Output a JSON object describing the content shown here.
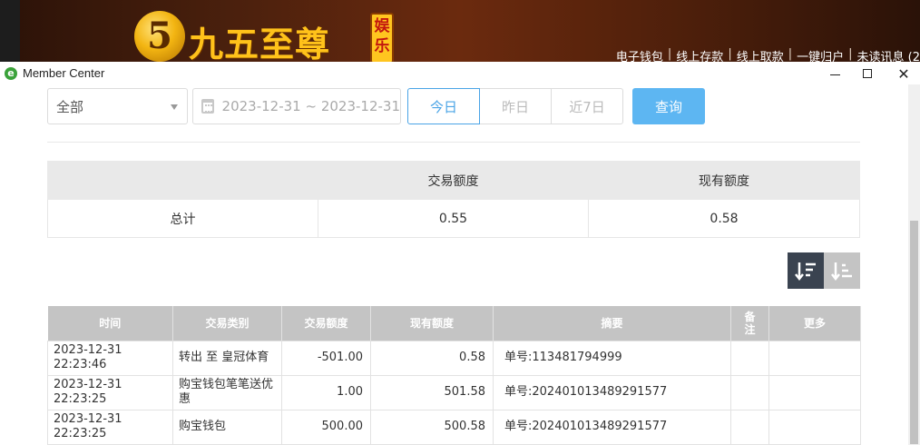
{
  "site": {
    "logo_number": "5",
    "logo_text": "九五至尊",
    "logo_tag": [
      "娱",
      "乐"
    ],
    "nav_links": [
      "电子钱包",
      "线上存款",
      "线上取款",
      "一键归户",
      "未读讯息 (2"
    ],
    "nav_separator": "|"
  },
  "window": {
    "title": "Member Center",
    "app_icon": "e",
    "close_glyph": "✕"
  },
  "filters": {
    "type_select": "全部",
    "date_range": "2023-12-31 ~ 2023-12-31",
    "quick": {
      "today": "今日",
      "yesterday": "昨日",
      "last7": "近7日"
    },
    "query_button": "查询"
  },
  "summary": {
    "headers": [
      "",
      "交易额度",
      "现有额度"
    ],
    "row": {
      "label": "总计",
      "amount": "0.55",
      "balance": "0.58"
    }
  },
  "detail": {
    "headers": [
      "时间",
      "交易类别",
      "交易额度",
      "现有额度",
      "摘要",
      "备注",
      "更多"
    ],
    "rows": [
      {
        "time": "2023-12-31 22:23:46",
        "type": "转出 至 皇冠体育",
        "amount": "-501.00",
        "balance": "0.58",
        "summary": "单号:113481794999",
        "note": "",
        "more": ""
      },
      {
        "time": "2023-12-31 22:23:25",
        "type": "购宝钱包笔笔送优惠",
        "amount": "1.00",
        "balance": "501.58",
        "summary": "单号:202401013489291577",
        "note": "",
        "more": ""
      },
      {
        "time": "2023-12-31 22:23:25",
        "type": "购宝钱包",
        "amount": "500.00",
        "balance": "500.58",
        "summary": "单号:202401013489291577",
        "note": "",
        "more": ""
      }
    ]
  },
  "icons": {
    "calendar": "calendar-icon",
    "sort_desc": "sort-descending-icon",
    "sort_asc": "sort-ascending-icon",
    "dropdown": "chevron-down-icon"
  },
  "colors": {
    "primary": "#5db6f2",
    "active_border": "#4aa4e6",
    "sort_active": "#3a4350",
    "table_header": "#c4c4c4"
  }
}
